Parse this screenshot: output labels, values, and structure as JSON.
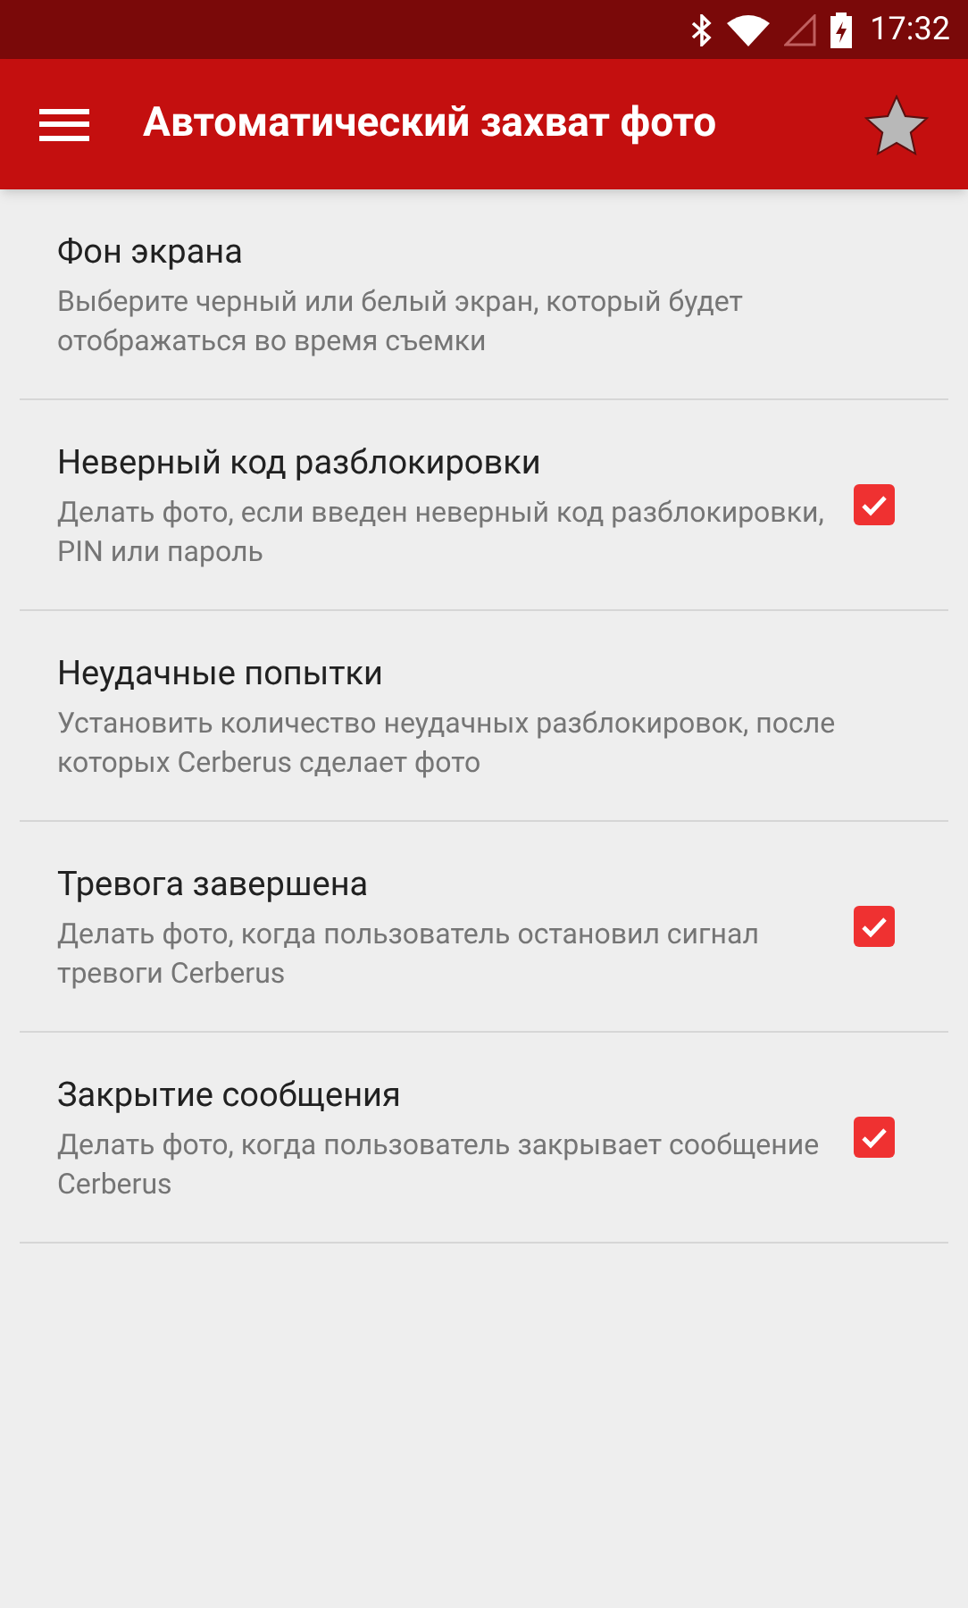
{
  "status_bar": {
    "time": "17:32"
  },
  "toolbar": {
    "title": "Автоматический захват фото"
  },
  "settings": [
    {
      "kind": "plain",
      "title": "Фон экрана",
      "summary": "Выберите черный или белый экран, который будет отображаться во время съемки"
    },
    {
      "kind": "checkbox",
      "title": "Неверный код разблокировки",
      "summary": "Делать фото, если введен неверный код разблокировки, PIN или пароль",
      "checked": true
    },
    {
      "kind": "plain",
      "title": "Неудачные попытки",
      "summary": "Установить количество неудачных разблокировок, после которых Cerberus сделает фото"
    },
    {
      "kind": "checkbox",
      "title": "Тревога завершена",
      "summary": "Делать фото, когда пользователь остановил сигнал тревоги Cerberus",
      "checked": true
    },
    {
      "kind": "checkbox",
      "title": "Закрытие сообщения",
      "summary": "Делать фото, когда пользователь закрывает сообщение Cerberus",
      "checked": true
    }
  ]
}
